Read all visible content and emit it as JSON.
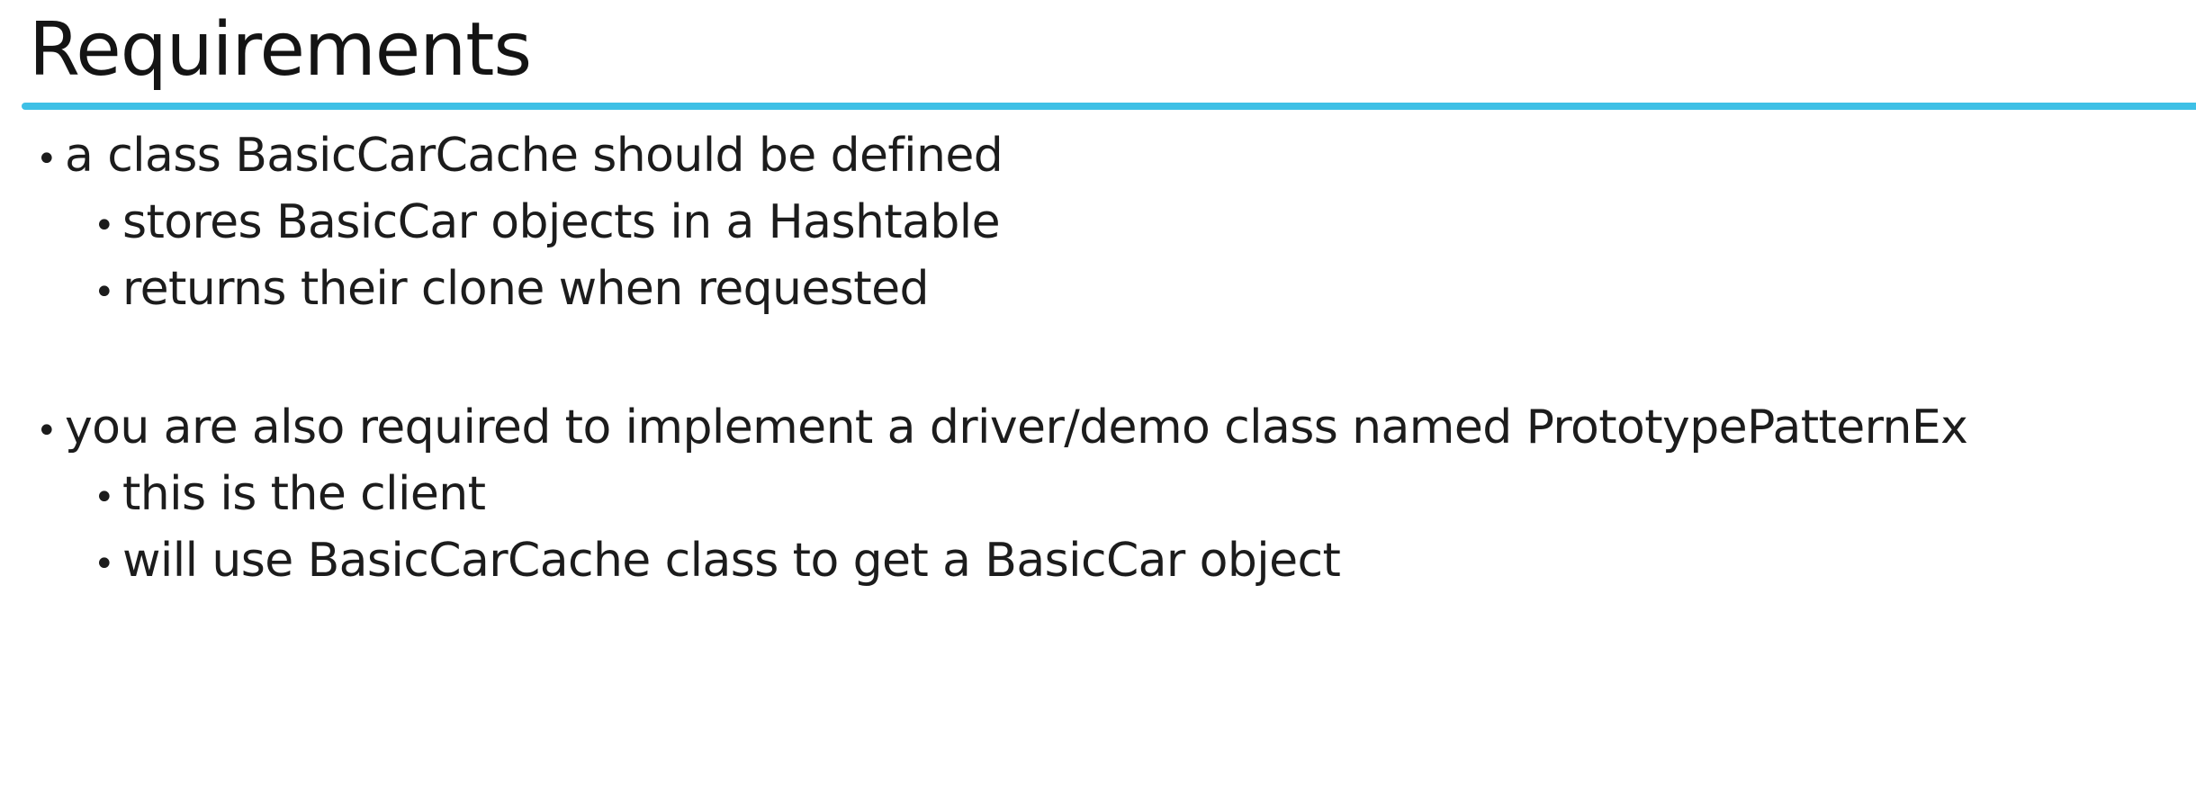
{
  "slide": {
    "title": "Requirements",
    "accent_color": "#3ec0e6",
    "bullet_glyph": "•",
    "groups": [
      {
        "text": "a class BasicCarCache should be defined",
        "subitems": [
          "stores BasicCar objects in a Hashtable",
          "returns their clone when requested"
        ]
      },
      {
        "text": "you are also required to implement a driver/demo class named PrototypePatternEx",
        "subitems": [
          "this is the client",
          "will use BasicCarCache class to get a BasicCar object"
        ]
      }
    ]
  }
}
